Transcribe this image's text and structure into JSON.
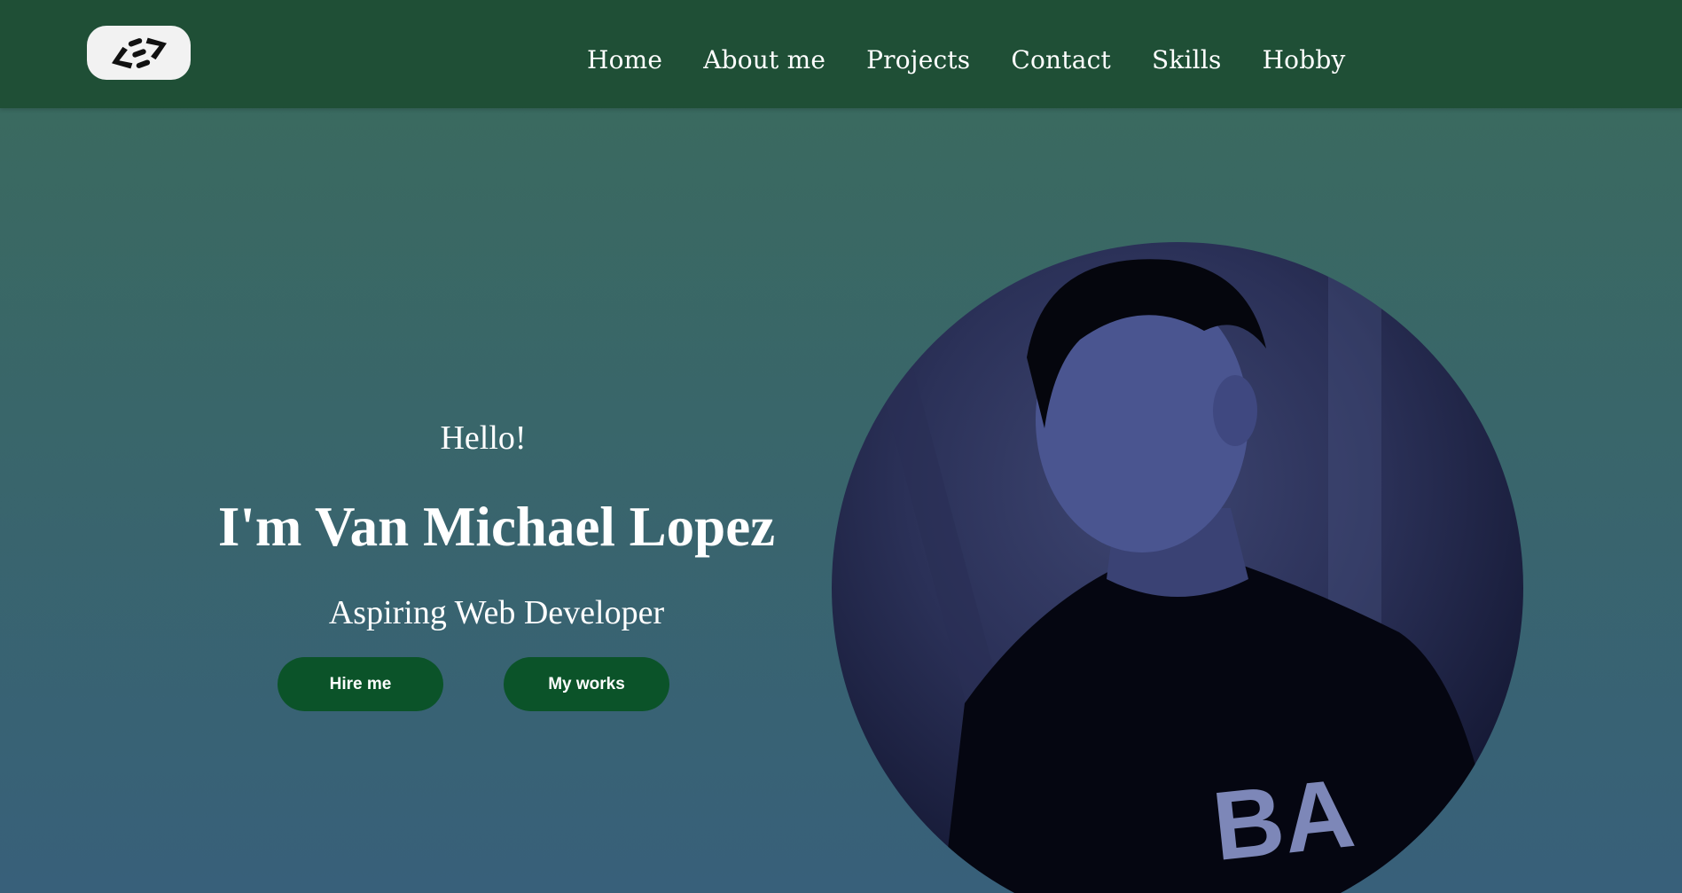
{
  "nav": {
    "logo_icon": "code-brackets-logo",
    "links": [
      "Home",
      "About me",
      "Projects",
      "Contact",
      "Skills",
      "Hobby"
    ]
  },
  "hero": {
    "greeting": "Hello!",
    "name": "I'm Van Michael Lopez",
    "role": "Aspiring Web Developer",
    "buttons": {
      "hire": "Hire me",
      "works": "My works"
    }
  },
  "profile": {
    "shirt_text": "BA"
  },
  "colors": {
    "nav_bg": "#1f4f36",
    "bg_top": "#3a6b5c",
    "bg_bottom": "#38607a",
    "button_bg": "#0b5329"
  }
}
